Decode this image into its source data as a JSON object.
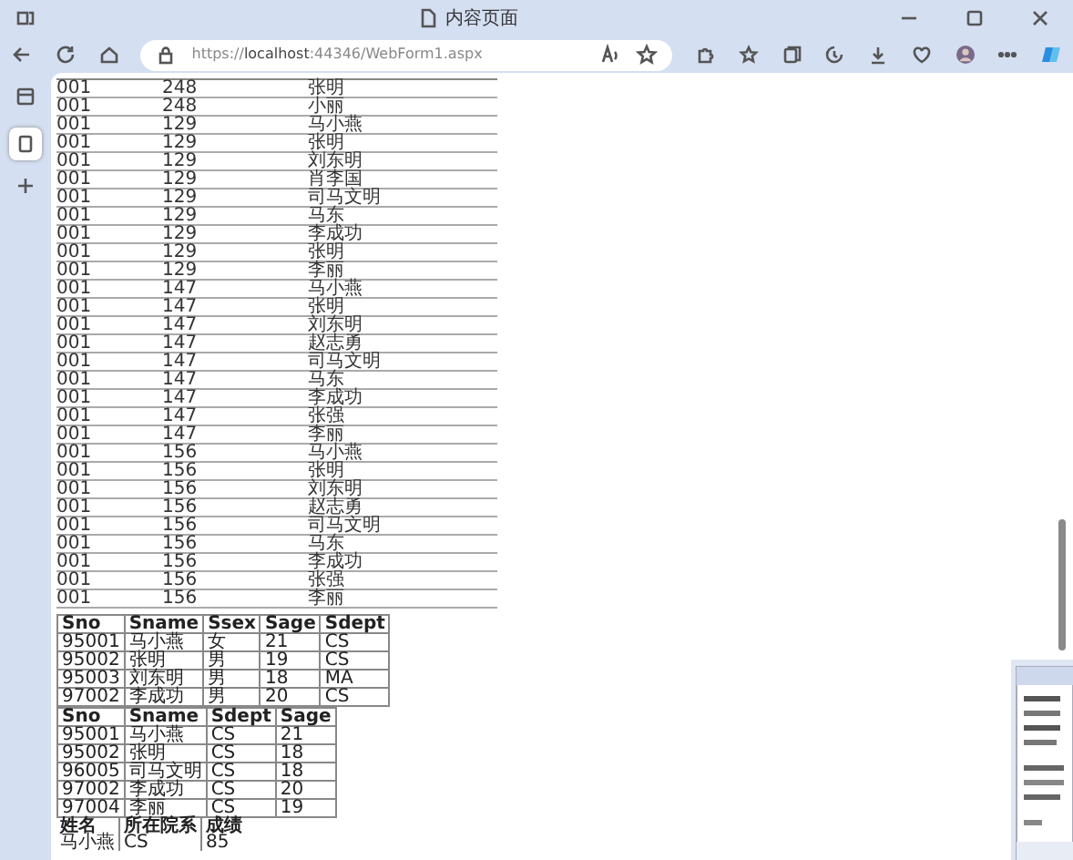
{
  "browser": {
    "tab_title": "内容页面",
    "url_scheme": "https://",
    "url_host": "localhost",
    "url_rest": ":44346/WebForm1.aspx",
    "sidebar_tabs": [
      {
        "selected": false
      },
      {
        "selected": true
      }
    ]
  },
  "score_table": {
    "rows": [
      [
        "001",
        "248",
        "张明"
      ],
      [
        "001",
        "248",
        "小丽"
      ],
      [
        "001",
        "129",
        "马小燕"
      ],
      [
        "001",
        "129",
        "张明"
      ],
      [
        "001",
        "129",
        "刘东明"
      ],
      [
        "001",
        "129",
        "肖李国"
      ],
      [
        "001",
        "129",
        "司马文明"
      ],
      [
        "001",
        "129",
        "马东"
      ],
      [
        "001",
        "129",
        "李成功"
      ],
      [
        "001",
        "129",
        "张明"
      ],
      [
        "001",
        "129",
        "李丽"
      ],
      [
        "001",
        "147",
        "马小燕"
      ],
      [
        "001",
        "147",
        "张明"
      ],
      [
        "001",
        "147",
        "刘东明"
      ],
      [
        "001",
        "147",
        "赵志勇"
      ],
      [
        "001",
        "147",
        "司马文明"
      ],
      [
        "001",
        "147",
        "马东"
      ],
      [
        "001",
        "147",
        "李成功"
      ],
      [
        "001",
        "147",
        "张强"
      ],
      [
        "001",
        "147",
        "李丽"
      ],
      [
        "001",
        "156",
        "马小燕"
      ],
      [
        "001",
        "156",
        "张明"
      ],
      [
        "001",
        "156",
        "刘东明"
      ],
      [
        "001",
        "156",
        "赵志勇"
      ],
      [
        "001",
        "156",
        "司马文明"
      ],
      [
        "001",
        "156",
        "马东"
      ],
      [
        "001",
        "156",
        "李成功"
      ],
      [
        "001",
        "156",
        "张强"
      ],
      [
        "001",
        "156",
        "李丽"
      ]
    ]
  },
  "student_table": {
    "columns": [
      "Sno",
      "Sname",
      "Ssex",
      "Sage",
      "Sdept"
    ],
    "rows": [
      [
        "95001",
        "马小燕",
        "女",
        "21",
        "CS"
      ],
      [
        "95002",
        "张明",
        "男",
        "19",
        "CS"
      ],
      [
        "95003",
        "刘东明",
        "男",
        "18",
        "MA"
      ],
      [
        "97002",
        "李成功",
        "男",
        "20",
        "CS"
      ]
    ]
  },
  "cs_table": {
    "columns": [
      "Sno",
      "Sname",
      "Sdept",
      "Sage"
    ],
    "rows": [
      [
        "95001",
        "马小燕",
        "CS",
        "21"
      ],
      [
        "95002",
        "张明",
        "CS",
        "18"
      ],
      [
        "96005",
        "司马文明",
        "CS",
        "18"
      ],
      [
        "97002",
        "李成功",
        "CS",
        "20"
      ],
      [
        "97004",
        "李丽",
        "CS",
        "19"
      ]
    ]
  },
  "grade_table": {
    "columns": [
      "姓名",
      "所在院系",
      "成绩"
    ],
    "rows": [
      [
        "马小燕",
        "CS",
        "85"
      ]
    ]
  }
}
